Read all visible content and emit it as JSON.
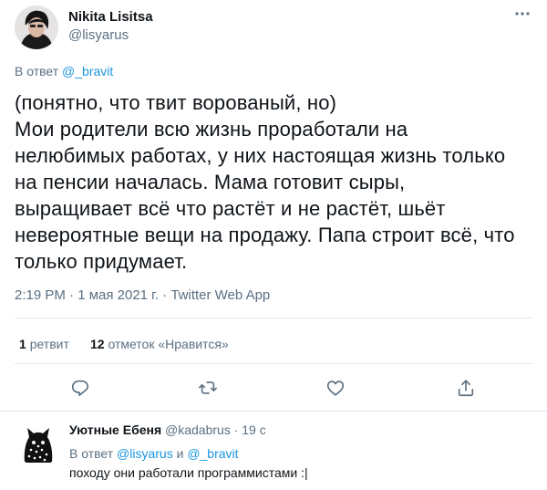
{
  "tweet": {
    "author": {
      "name": "Nikita Lisitsa",
      "handle": "@lisyarus"
    },
    "reply_prefix": "В ответ",
    "reply_to": "@_bravit",
    "text_lines": [
      "(понятно, что твит ворованый, но)",
      "Мои родители всю жизнь проработали на",
      "нелюбимых работах, у них настоящая жизнь только",
      "на пенсии началась. Мама готовит сыры,",
      "выращивает всё что растёт и не растёт, шьёт",
      "невероятные вещи на продажу. Папа строит всё, что",
      "только придумает."
    ],
    "timestamp": "2:19 PM · 1 мая 2021 г. · Twitter Web App",
    "stats": {
      "retweets_count": "1",
      "retweets_label": "ретвит",
      "likes_count": "12",
      "likes_label": "отметок «Нравится»"
    },
    "more_icon": "more-dots-icon",
    "actions": [
      "reply-icon",
      "retweet-icon",
      "like-icon",
      "share-icon"
    ]
  },
  "reply": {
    "author": {
      "name": "Уютные Ебеня",
      "handle": "@kadabrus",
      "time": "· 19 с"
    },
    "reply_prefix": "В ответ",
    "reply_to_1": "@lisyarus",
    "reply_join": "и",
    "reply_to_2": "@_bravit",
    "text": "походу они работали программистами :|"
  },
  "colors": {
    "link": "#1b95e0",
    "muted": "#5b7083",
    "divider": "#e1e8ed"
  }
}
